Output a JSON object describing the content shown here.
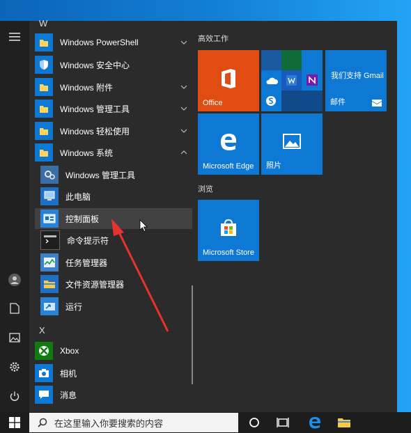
{
  "applist": {
    "letters": {
      "w": "W",
      "x": "X"
    },
    "items": [
      {
        "label": "Windows PowerShell",
        "expandable": true
      },
      {
        "label": "Windows 安全中心",
        "expandable": false
      },
      {
        "label": "Windows 附件",
        "expandable": true
      },
      {
        "label": "Windows 管理工具",
        "expandable": true
      },
      {
        "label": "Windows 轻松使用",
        "expandable": true
      },
      {
        "label": "Windows 系统",
        "expanded": true
      },
      {
        "label": "Windows 管理工具"
      },
      {
        "label": "此电脑"
      },
      {
        "label": "控制面板",
        "selected": true
      },
      {
        "label": "命令提示符"
      },
      {
        "label": "任务管理器"
      },
      {
        "label": "文件资源管理器"
      },
      {
        "label": "运行"
      },
      {
        "label": "Xbox"
      },
      {
        "label": "相机"
      },
      {
        "label": "消息"
      }
    ]
  },
  "tiles": {
    "section1": "高效工作",
    "section2": "浏览",
    "office": "Office",
    "gmail": "我们支持 Gmail",
    "mail": "邮件",
    "edge": "Microsoft Edge",
    "photos": "照片",
    "store": "Microsoft Store"
  },
  "taskbar": {
    "search_placeholder": "在这里输入你要搜索的内容"
  },
  "colors": {
    "tile_blue": "#0e78d5",
    "office_orange": "#e14c12",
    "arrow_red": "#e8322d"
  }
}
